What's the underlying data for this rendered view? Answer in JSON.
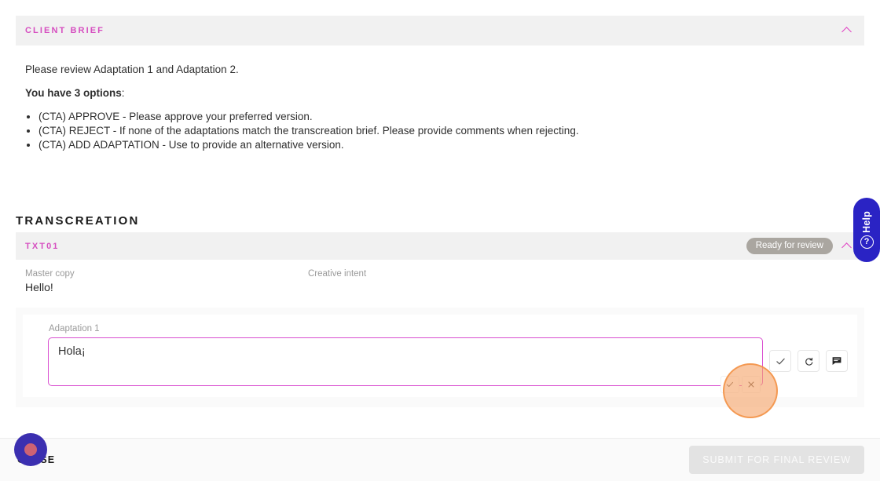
{
  "brief": {
    "title": "CLIENT BRIEF",
    "collapse_icon": "chevron-up-icon",
    "intro": "Please review Adaptation 1 and Adaptation 2.",
    "options_heading": "You have 3 options",
    "options_heading_suffix": ":",
    "options": [
      "(CTA) APPROVE - Please approve your preferred version.",
      "(CTA) REJECT - If none of the adaptations match the transcreation brief. Please provide comments when rejecting.",
      "(CTA) ADD ADAPTATION - Use to provide an alternative version."
    ]
  },
  "transcreation": {
    "section_title": "TRANSCREATION",
    "card": {
      "code": "TXT01",
      "status": "Ready for review",
      "collapse_icon": "chevron-up-icon",
      "master_copy_label": "Master copy",
      "master_copy_value": "Hello!",
      "creative_intent_label": "Creative intent",
      "creative_intent_value": "",
      "adaptation": {
        "label": "Adaptation 1",
        "value": "Hola¡",
        "placeholder": "",
        "actions": [
          {
            "name": "approve-adaptation-button",
            "icon": "check-icon"
          },
          {
            "name": "reset-adaptation-button",
            "icon": "refresh-icon"
          },
          {
            "name": "comment-adaptation-button",
            "icon": "comment-icon"
          }
        ],
        "mini_actions": [
          {
            "name": "confirm-edit-button",
            "icon": "check-icon"
          },
          {
            "name": "cancel-edit-button",
            "icon": "close-icon"
          }
        ]
      }
    }
  },
  "help_widget": {
    "label": "Help",
    "icon": "question-circle-icon"
  },
  "footer": {
    "close_label": "CLOSE",
    "submit_label": "SUBMIT FOR FINAL REVIEW"
  },
  "colors": {
    "accent_pink": "#d64ec0",
    "input_border": "#d94fd0",
    "help_blue": "#2a23c4",
    "badge_gray": "#aaa6a0",
    "header_gray": "#f1f1f1",
    "highlight_orange": "#f3a05c"
  }
}
